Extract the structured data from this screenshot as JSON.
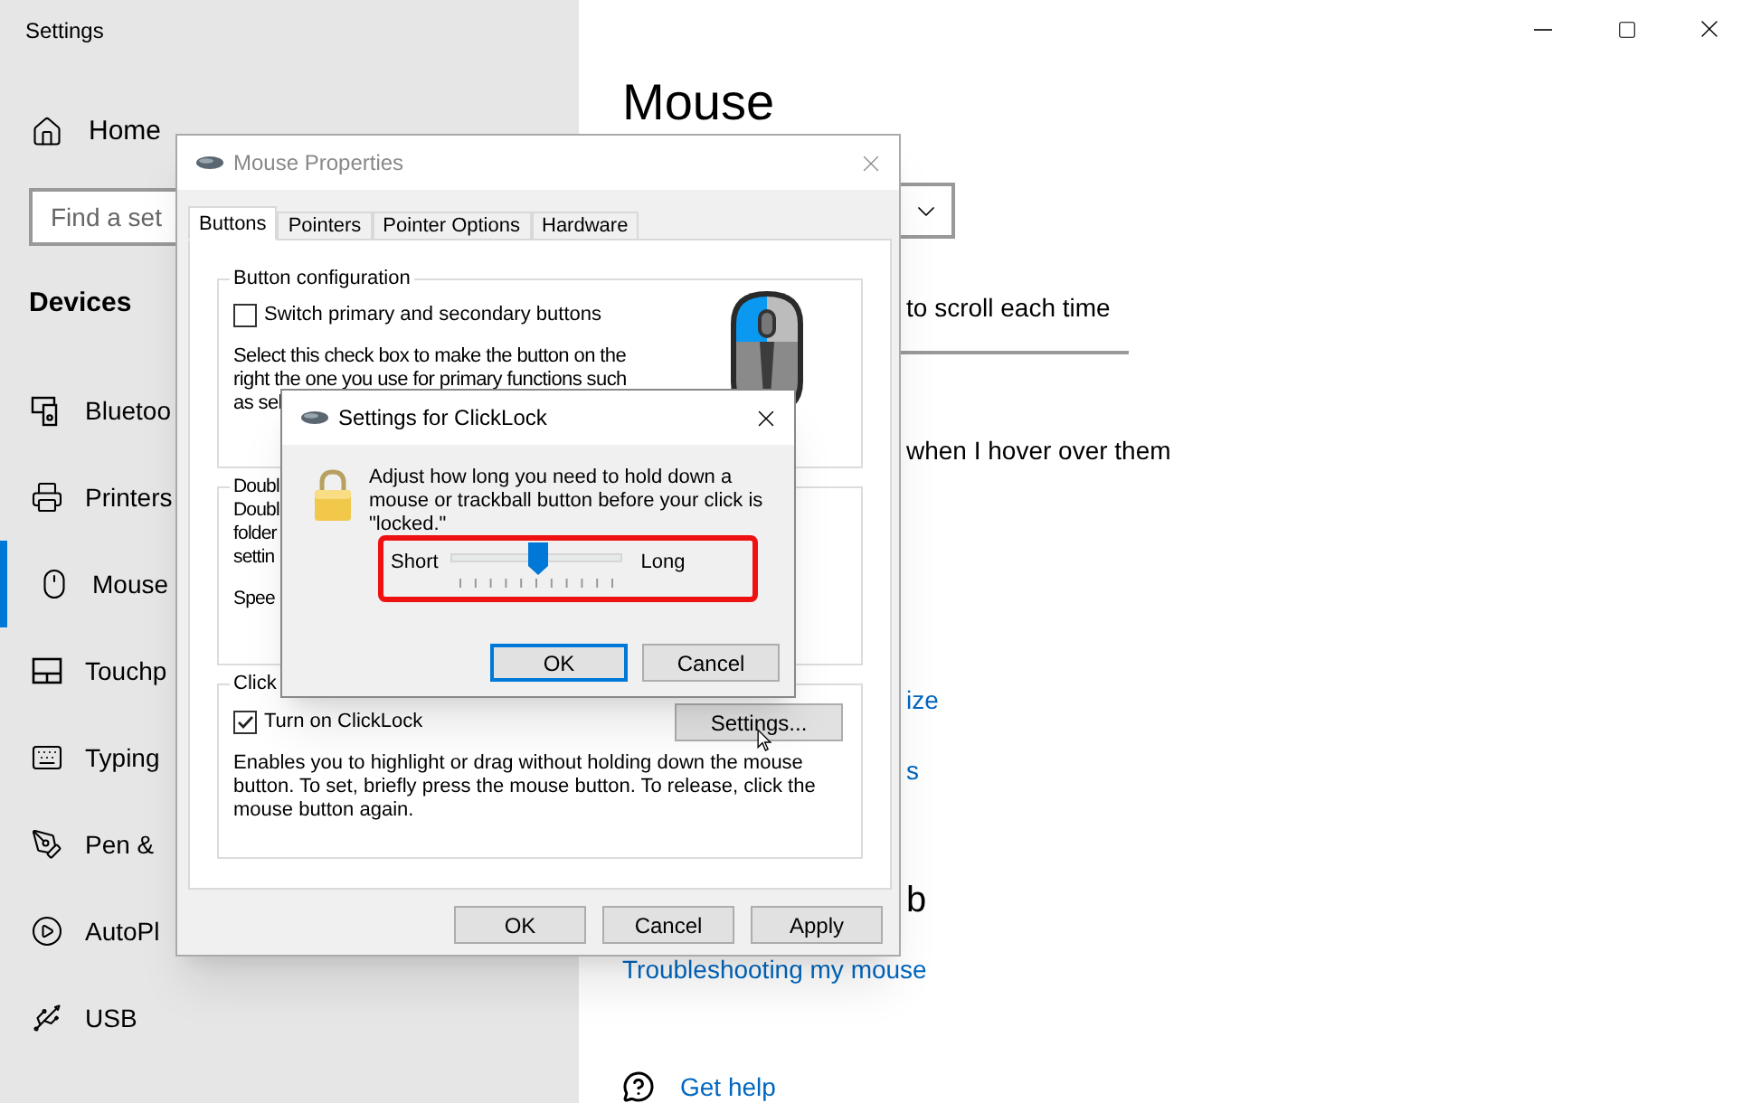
{
  "settings_window": {
    "title": "Settings"
  },
  "sidebar": {
    "home": "Home",
    "search": {
      "placeholder": "Find a set"
    },
    "section": "Devices",
    "items": [
      {
        "label": "Bluetoo",
        "selected": false
      },
      {
        "label": "Printers",
        "selected": false
      },
      {
        "label": "Mouse",
        "selected": true
      },
      {
        "label": "Touchp",
        "selected": false
      },
      {
        "label": "Typing",
        "selected": false
      },
      {
        "label": "Pen &",
        "selected": false
      },
      {
        "label": "AutoPl",
        "selected": false
      },
      {
        "label": "USB",
        "selected": false
      }
    ]
  },
  "main": {
    "heading": "Mouse",
    "scroll_text": "to scroll each time",
    "hover_text": "when I hover over them",
    "links": [
      "ize",
      "s"
    ],
    "heading_2": "b",
    "troubleshoot_link": "Troubleshooting my mouse",
    "help_link": "Get help"
  },
  "mouse_properties": {
    "title": "Mouse Properties",
    "tabs": [
      {
        "label": "Buttons",
        "selected": true
      },
      {
        "label": "Pointers",
        "selected": false
      },
      {
        "label": "Pointer Options",
        "selected": false
      },
      {
        "label": "Hardware",
        "selected": false
      }
    ],
    "button_configuration": {
      "legend": "Button configuration",
      "checkbox": {
        "label": "Switch primary and secondary buttons",
        "checked": false
      },
      "description": "Select this check box to make the button on the right the one you use for primary functions such as sel"
    },
    "double_click": {
      "legend": "Doubl",
      "lines": [
        "Doubl",
        "folder",
        "settin"
      ],
      "speed_label": "Spee"
    },
    "clicklock": {
      "legend": "Click",
      "checkbox": {
        "label": "Turn on ClickLock",
        "checked": true
      },
      "settings_button": "Settings...",
      "description": "Enables you to highlight or drag without holding down the mouse button. To set, briefly press the mouse button. To release, click the mouse button again."
    },
    "buttons": [
      "OK",
      "Cancel",
      "Apply"
    ]
  },
  "clicklock_dialog": {
    "title": "Settings for ClickLock",
    "message": "Adjust how long you need to hold down a mouse or trackball button before your click is \"locked.\"",
    "slider": {
      "min_label": "Short",
      "max_label": "Long",
      "level": 0.5
    },
    "buttons": [
      {
        "label": "OK",
        "default": true
      },
      {
        "label": "Cancel",
        "default": false
      }
    ]
  }
}
